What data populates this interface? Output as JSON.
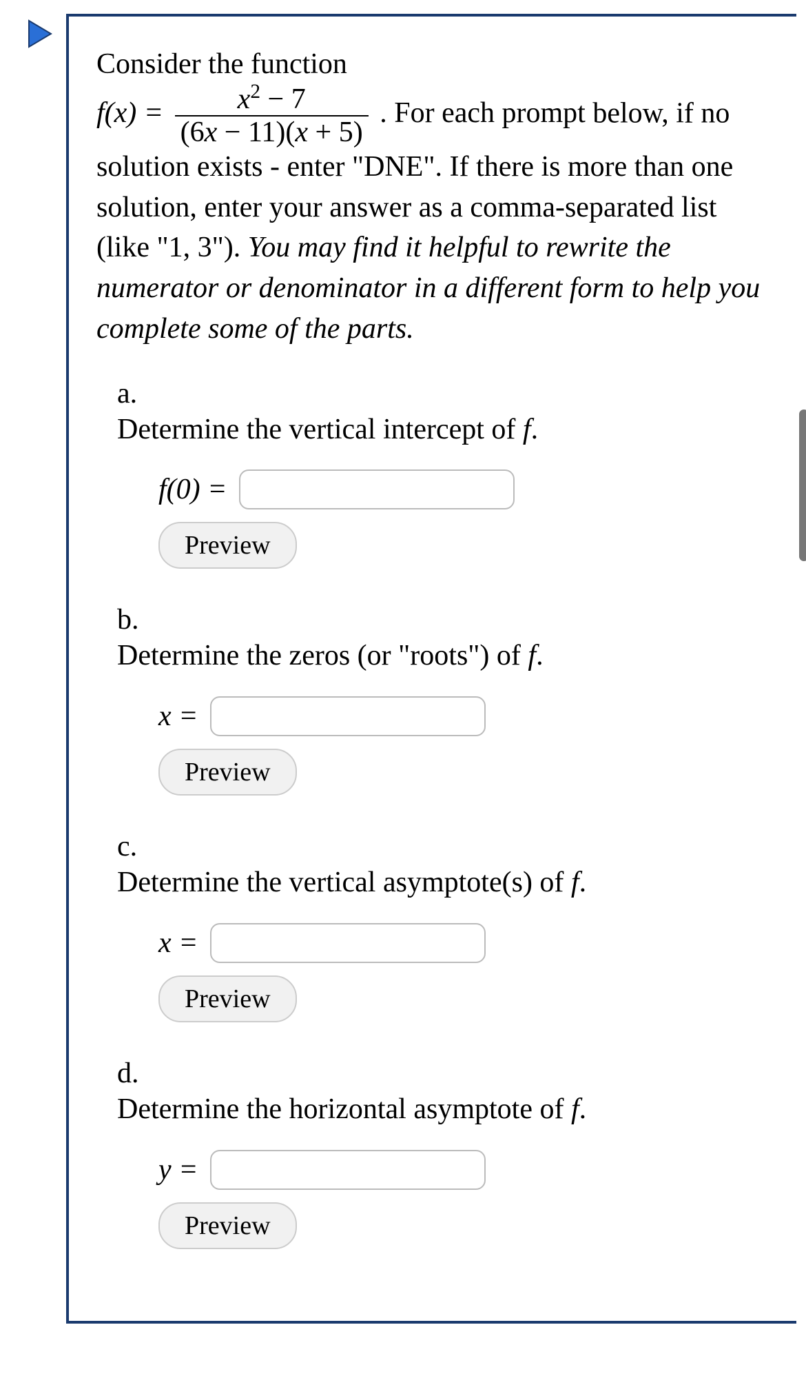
{
  "intro": {
    "line1": "Consider the function",
    "func_lhs": "f(x) = ",
    "numerator_pre": "x",
    "numerator_exp": "2",
    "numerator_post": " − 7",
    "denominator": "(6x − 11)(x + 5)",
    "after_frac": ". For each prompt",
    "line3": "below, if no solution exists - enter \"DNE\". If there is more than one solution, enter your answer as a comma-separated list (like \"1, 3\").",
    "hint": "You may find it helpful to rewrite the numerator or denominator in a different form to help you complete some of the parts."
  },
  "parts": {
    "a": {
      "label": "a.",
      "text_pre": "Determine the vertical intercept of ",
      "text_fn": "f",
      "text_post": ".",
      "answer_label": "f(0) = ",
      "preview": "Preview"
    },
    "b": {
      "label": "b.",
      "text_pre": "Determine the zeros (or \"roots\") of ",
      "text_fn": "f",
      "text_post": ".",
      "answer_label": "x = ",
      "preview": "Preview"
    },
    "c": {
      "label": "c.",
      "text_pre": "Determine the vertical asymptote(s) of ",
      "text_fn": "f",
      "text_post": ".",
      "answer_label": "x = ",
      "preview": "Preview"
    },
    "d": {
      "label": "d.",
      "text_pre": "Determine the horizontal asymptote of ",
      "text_fn": "f",
      "text_post": ".",
      "answer_label": "y = ",
      "preview": "Preview"
    }
  }
}
